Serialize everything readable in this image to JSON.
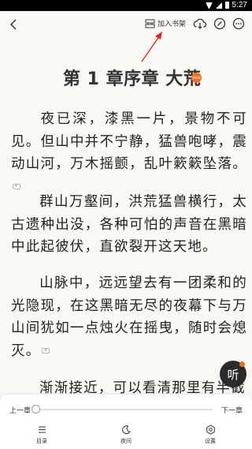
{
  "status_bar": {
    "time": "5:27"
  },
  "top_bar": {
    "add_to_shelf": "加入书架"
  },
  "chapter": {
    "title": "第 1 章序章 大荒",
    "title_badge": "new",
    "paragraphs": [
      "夜已深，漆黑一片，景物不可见。但山中并不宁静，猛兽咆哮，震动山河，万木摇颤，乱叶簌簌坠落。",
      "群山万壑间，洪荒猛兽横行，太古遗种出没，各种可怕的声音在黑暗中此起彼伏，直欲裂开这天地。",
      "山脉中，远远望去有一团柔和的光隐现，在这黑暗无尽的夜幕下与万山间犹如一点烛火在摇曳，随时会熄灭。",
      "渐渐接近，可以看清那里有半截"
    ]
  },
  "listen_button": {
    "label": "听"
  },
  "bottom_bar": {
    "prev_chapter": "上一章",
    "next_chapter": "下一章",
    "progress": 0.0,
    "nav": [
      {
        "label": "目录",
        "icon": "list-icon"
      },
      {
        "label": "夜间",
        "icon": "moon-icon"
      },
      {
        "label": "设置",
        "icon": "settings-icon"
      }
    ]
  },
  "colors": {
    "accent": "#f07020",
    "background": "#faf8f5",
    "arrow": "#e02020"
  }
}
